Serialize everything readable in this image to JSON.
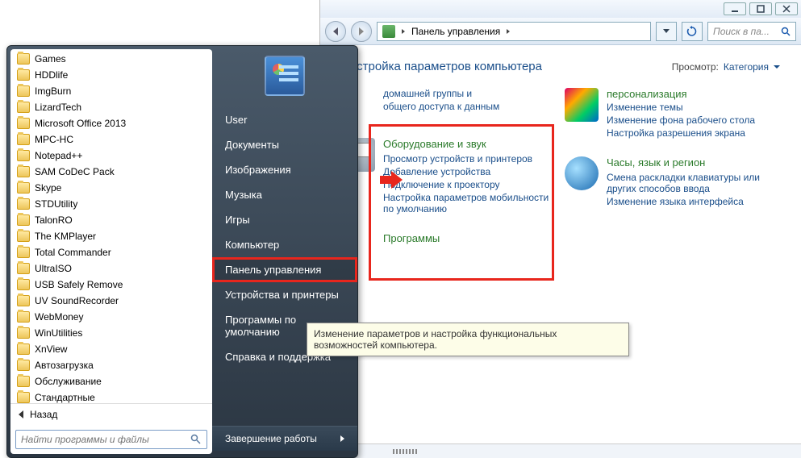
{
  "start": {
    "programs": [
      "Games",
      "HDDlife",
      "ImgBurn",
      "LizardTech",
      "Microsoft Office 2013",
      "MPC-HC",
      "Notepad++",
      "SAM CoDeC Pack",
      "Skype",
      "STDUtility",
      "TalonRO",
      "The KMPlayer",
      "Total Commander",
      "UltraISO",
      "USB Safely Remove",
      "UV SoundRecorder",
      "WebMoney",
      "WinUtilities",
      "XnView",
      "Автозагрузка",
      "Обслуживание",
      "Стандартные"
    ],
    "back": "Назад",
    "search_placeholder": "Найти программы и файлы",
    "right_items": [
      "User",
      "Документы",
      "Изображения",
      "Музыка",
      "Игры",
      "Компьютер",
      "Панель управления",
      "Устройства и принтеры",
      "Программы по умолчанию",
      "Справка и поддержка"
    ],
    "shutdown": "Завершение работы"
  },
  "tooltip": "Изменение параметров и настройка функциональных возможностей компьютера.",
  "cp": {
    "breadcrumb": "Панель управления",
    "search_placeholder": "Поиск в па...",
    "title": "Настройка параметров компьютера",
    "view_label": "Просмотр:",
    "view_value": "Категория",
    "left_col": {
      "top_links": [
        "домашней группы и",
        "общего доступа к данным"
      ],
      "hw": {
        "title": "Оборудование и звук",
        "links": [
          "Просмотр устройств и принтеров",
          "Добавление устройства",
          "Подключение к проектору",
          "Настройка параметров мобильности по умолчанию"
        ]
      },
      "programs_title_partial": "Программы"
    },
    "right_col": {
      "appearance": {
        "title_partial": "персонализация",
        "links": [
          "Изменение темы",
          "Изменение фона рабочего стола",
          "Настройка разрешения экрана"
        ]
      },
      "clock": {
        "title": "Часы, язык и регион",
        "links": [
          "Смена раскладки клавиатуры или других способов ввода",
          "Изменение языка интерфейса"
        ]
      }
    }
  }
}
